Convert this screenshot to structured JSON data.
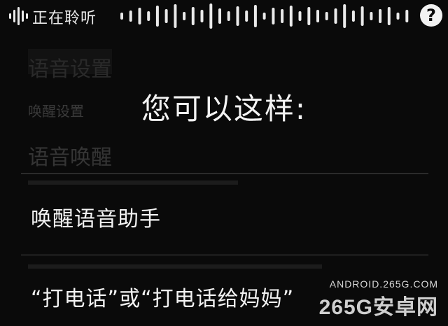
{
  "status": {
    "listening_label": "正在聆听",
    "help_glyph": "?"
  },
  "background_screen": {
    "title": "语音设置",
    "section_header": "唤醒设置",
    "item_1": "语音唤醒"
  },
  "hint": {
    "title": "您可以这样:",
    "suggestions": [
      "唤醒语音助手",
      "“打电话”或“打电话给妈妈”"
    ]
  },
  "watermark": {
    "url": "ANDROID.265G.COM",
    "brand": "265G安卓网"
  },
  "colors": {
    "background": "#0a0a0a",
    "text": "#f3f3f3",
    "divider": "#4a4a4a"
  }
}
